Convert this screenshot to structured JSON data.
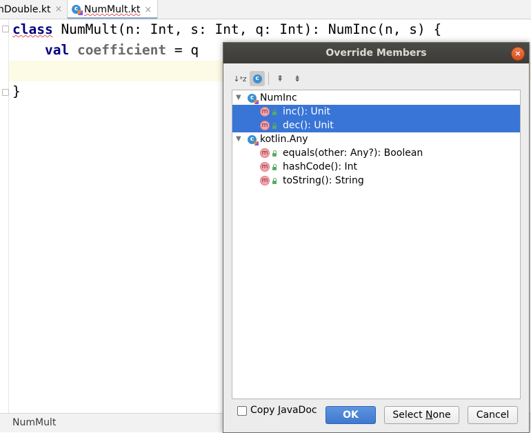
{
  "tabs": [
    {
      "label": "nDouble.kt",
      "close": "×"
    },
    {
      "label": "NumMult.kt",
      "close": "×"
    }
  ],
  "code": {
    "line1": {
      "kw": "class",
      "rest": " NumMult(n: Int, s: Int, q: Int): NumInc(n, s) {"
    },
    "line2": {
      "indent": "    ",
      "kw": "val",
      "space": " ",
      "prop": "coefficient",
      "rest": " = q"
    },
    "line4": "}"
  },
  "status": {
    "breadcrumb": "NumMult"
  },
  "dialog": {
    "title": "Override Members",
    "close_symbol": "×",
    "toolbar": {
      "sort_icon": "↓ᵃz",
      "class_icon": "c",
      "expand_icon": "⇞",
      "collapse_icon": "⇟"
    },
    "tree": {
      "groups": [
        {
          "name": "NumInc",
          "items": [
            {
              "label": "inc(): Unit",
              "selected": true
            },
            {
              "label": "dec(): Unit",
              "selected": true
            }
          ]
        },
        {
          "name": "kotlin.Any",
          "items": [
            {
              "label": "equals(other: Any?): Boolean",
              "selected": false
            },
            {
              "label": "hashCode(): Int",
              "selected": false
            },
            {
              "label": "toString(): String",
              "selected": false
            }
          ]
        }
      ]
    },
    "copy_javadoc": {
      "label_pre": "Copy ",
      "label_mn": "J",
      "label_post": "avaDoc",
      "checked": false
    },
    "buttons": {
      "ok": "OK",
      "select_none_pre": "Select ",
      "select_none_mn": "N",
      "select_none_post": "one",
      "cancel": "Cancel"
    },
    "colors": {
      "selection": "#3875d6",
      "titlebar": "#3c3b37",
      "close": "#e05a24"
    }
  }
}
